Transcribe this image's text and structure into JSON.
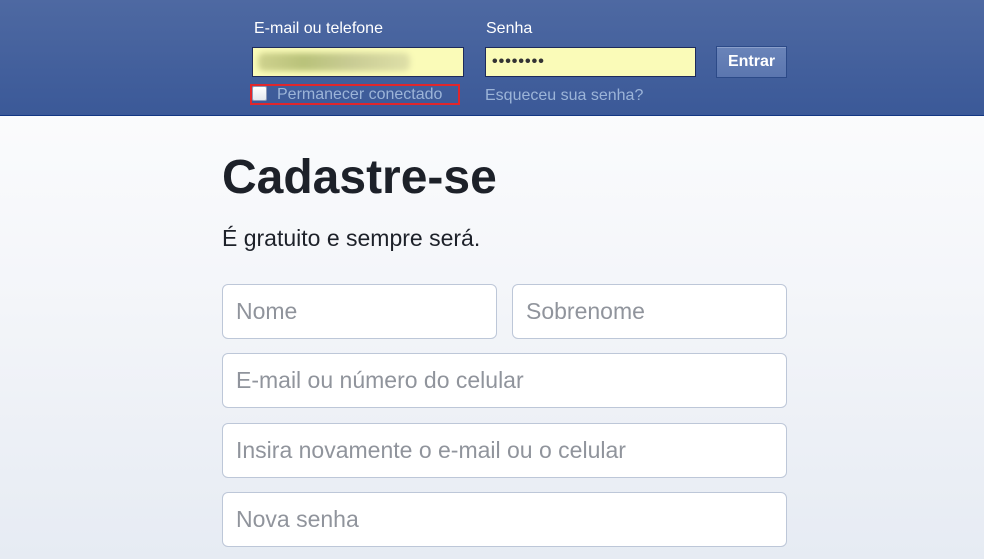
{
  "login": {
    "email_label": "E-mail ou telefone",
    "email_value": "",
    "password_label": "Senha",
    "password_value": "••••••••",
    "submit_label": "Entrar",
    "keep_logged_in_label": "Permanecer conectado",
    "keep_logged_in_checked": false,
    "forgot_password_link": "Esqueceu sua senha?"
  },
  "signup": {
    "title": "Cadastre-se",
    "subtitle": "É gratuito e sempre será.",
    "first_name_placeholder": "Nome",
    "last_name_placeholder": "Sobrenome",
    "email_placeholder": "E-mail ou número do celular",
    "email_confirm_placeholder": "Insira novamente o e-mail ou o celular",
    "new_password_placeholder": "Nova senha"
  },
  "colors": {
    "header_bg": "#3b5998",
    "login_input_bg": "#fafbb8",
    "highlight_border": "#e0262c",
    "link_color": "#9cb4d8"
  }
}
